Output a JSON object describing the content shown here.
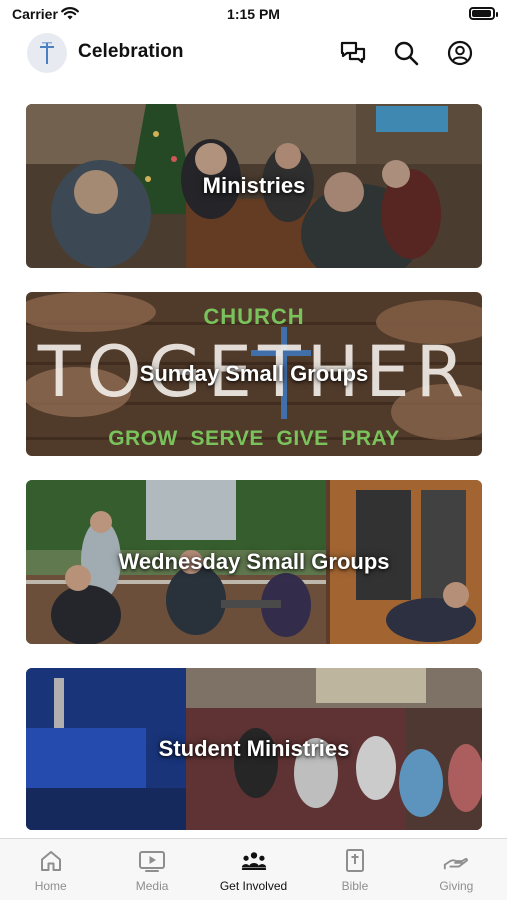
{
  "status_bar": {
    "carrier": "Carrier",
    "time": "1:15 PM",
    "battery_level": 0.95
  },
  "header": {
    "title": "Celebration",
    "icons": [
      "chat-icon",
      "search-icon",
      "profile-icon"
    ]
  },
  "cards": [
    {
      "label": "Ministries"
    },
    {
      "label": "Sunday Small Groups",
      "image_text": {
        "top": "CHURCH",
        "middle": "TOGETHER",
        "bottom": "GROW  SERVE  GIVE  PRAY"
      }
    },
    {
      "label": "Wednesday Small Groups"
    },
    {
      "label": "Student Ministries"
    }
  ],
  "tabs": [
    {
      "label": "Home",
      "icon": "home-icon",
      "active": false
    },
    {
      "label": "Media",
      "icon": "media-icon",
      "active": false
    },
    {
      "label": "Get Involved",
      "icon": "people-icon",
      "active": true
    },
    {
      "label": "Bible",
      "icon": "bible-icon",
      "active": false
    },
    {
      "label": "Giving",
      "icon": "giving-icon",
      "active": false
    }
  ],
  "colors": {
    "accent": "#111111",
    "inactive_tab": "#8e8e8e",
    "logo_cross": "#4a7fc1",
    "image_green": "#7ac35c"
  }
}
